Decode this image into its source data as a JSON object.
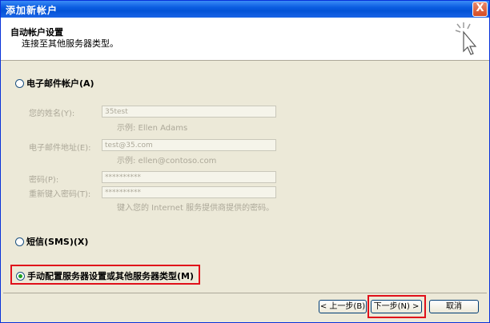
{
  "window": {
    "title": "添加新帐户",
    "close_glyph": "X"
  },
  "header": {
    "title": "自动帐户设置",
    "subtitle": "连接至其他服务器类型。"
  },
  "email_account": {
    "radio_label": "电子邮件帐户(A)",
    "name_label": "您的姓名(Y):",
    "name_value": "35test",
    "name_hint": "示例: Ellen Adams",
    "email_label": "电子邮件地址(E):",
    "email_value": "test@35.com",
    "email_hint": "示例: ellen@contoso.com",
    "password_label": "密码(P):",
    "password_value": "**********",
    "retype_label": "重新键入密码(T):",
    "retype_value": "**********",
    "password_hint": "键入您的 Internet 服务提供商提供的密码。"
  },
  "sms": {
    "radio_label": "短信(SMS)(X)"
  },
  "manual": {
    "radio_label": "手动配置服务器设置或其他服务器类型(M)"
  },
  "buttons": {
    "back": "< 上一步(B)",
    "next": "下一步(N) >",
    "cancel": "取消"
  },
  "colors": {
    "title_bar": "#0a5ce0",
    "highlight": "#e0101a",
    "selected_radio": "#21a121"
  }
}
